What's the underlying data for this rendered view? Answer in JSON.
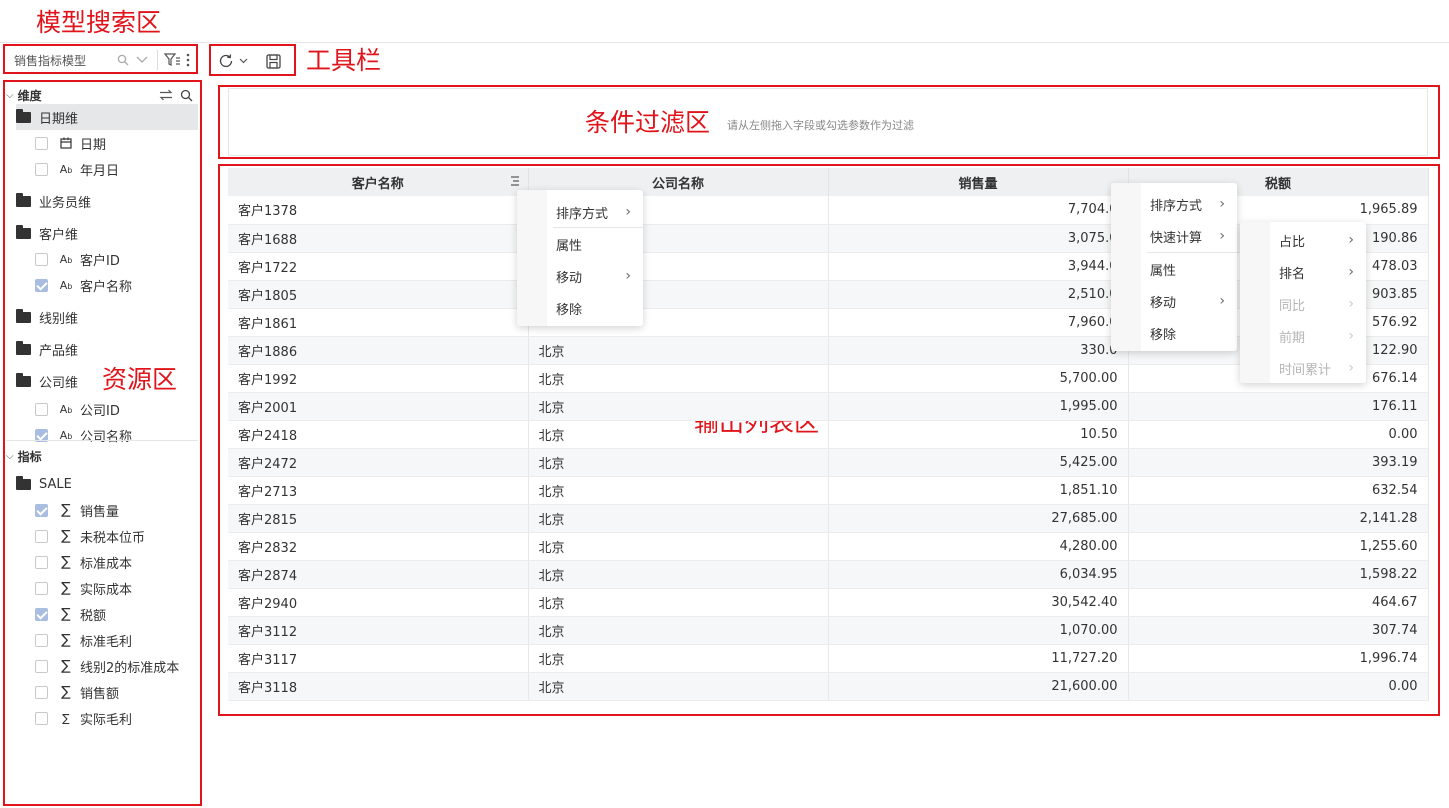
{
  "annotations": {
    "model_search": "模型搜索区",
    "toolbar": "工具栏",
    "filter": "条件过滤区",
    "resource": "资源区",
    "output": "输出列表区"
  },
  "model_search": {
    "value": "销售指标模型"
  },
  "filter_area": {
    "hint": "请从左侧拖入字段或勾选参数作为过滤"
  },
  "tree": {
    "dimension_title": "维度",
    "metric_title": "指标",
    "nodes": [
      {
        "type": "folder",
        "label": "日期维",
        "selected": true
      },
      {
        "type": "field",
        "icon": "calendar",
        "label": "日期",
        "checked": false
      },
      {
        "type": "field",
        "icon": "text",
        "label": "年月日",
        "checked": false
      },
      {
        "type": "folder",
        "label": "业务员维"
      },
      {
        "type": "folder",
        "label": "客户维"
      },
      {
        "type": "field",
        "icon": "text",
        "label": "客户ID",
        "checked": false
      },
      {
        "type": "field",
        "icon": "text",
        "label": "客户名称",
        "checked": true
      },
      {
        "type": "folder",
        "label": "线别维"
      },
      {
        "type": "folder",
        "label": "产品维"
      },
      {
        "type": "folder",
        "label": "公司维"
      },
      {
        "type": "field",
        "icon": "text",
        "label": "公司ID",
        "checked": false
      },
      {
        "type": "field",
        "icon": "text",
        "label": "公司名称",
        "checked": true
      }
    ],
    "metrics": [
      {
        "type": "folder",
        "label": "SALE"
      },
      {
        "icon": "sigma",
        "label": "销售量",
        "checked": true
      },
      {
        "icon": "sigma",
        "label": "未税本位币",
        "checked": false
      },
      {
        "icon": "sigma",
        "label": "标准成本",
        "checked": false
      },
      {
        "icon": "sigma",
        "label": "实际成本",
        "checked": false
      },
      {
        "icon": "sigma",
        "label": "税额",
        "checked": true
      },
      {
        "icon": "sigma",
        "label": "标准毛利",
        "checked": false
      },
      {
        "icon": "sigma",
        "label": "线别2的标准成本",
        "checked": false
      },
      {
        "icon": "sigma",
        "label": "销售额",
        "checked": false
      },
      {
        "icon": "calc-sigma",
        "label": "实际毛利",
        "checked": false
      }
    ]
  },
  "table": {
    "columns": [
      "客户名称",
      "公司名称",
      "销售量",
      "税额"
    ],
    "rows": [
      [
        "客户1378",
        "",
        "7,704.0",
        "1,965.89"
      ],
      [
        "客户1688",
        "",
        "3,075.0",
        "190.86"
      ],
      [
        "客户1722",
        "",
        "3,944.0",
        "478.03"
      ],
      [
        "客户1805",
        "",
        "2,510.0",
        "903.85"
      ],
      [
        "客户1861",
        "",
        "7,960.0",
        "576.92"
      ],
      [
        "客户1886",
        "北京",
        "330.0",
        "122.90"
      ],
      [
        "客户1992",
        "北京",
        "5,700.00",
        "676.14"
      ],
      [
        "客户2001",
        "北京",
        "1,995.00",
        "176.11"
      ],
      [
        "客户2418",
        "北京",
        "10.50",
        "0.00"
      ],
      [
        "客户2472",
        "北京",
        "5,425.00",
        "393.19"
      ],
      [
        "客户2713",
        "北京",
        "1,851.10",
        "632.54"
      ],
      [
        "客户2815",
        "北京",
        "27,685.00",
        "2,141.28"
      ],
      [
        "客户2832",
        "北京",
        "4,280.00",
        "1,255.60"
      ],
      [
        "客户2874",
        "北京",
        "6,034.95",
        "1,598.22"
      ],
      [
        "客户2940",
        "北京",
        "30,542.40",
        "464.67"
      ],
      [
        "客户3112",
        "北京",
        "1,070.00",
        "307.74"
      ],
      [
        "客户3117",
        "北京",
        "11,727.20",
        "1,996.74"
      ],
      [
        "客户3118",
        "北京",
        "21,600.00",
        "0.00"
      ]
    ]
  },
  "menus": {
    "col1": [
      {
        "label": "排序方式",
        "submenu": true
      },
      {
        "label": "属性",
        "submenu": false
      },
      {
        "label": "移动",
        "submenu": true
      },
      {
        "label": "移除",
        "submenu": false
      }
    ],
    "col3": [
      {
        "label": "排序方式",
        "submenu": true
      },
      {
        "label": "快速计算",
        "submenu": true
      },
      {
        "label": "属性",
        "submenu": false
      },
      {
        "label": "移动",
        "submenu": true
      },
      {
        "label": "移除",
        "submenu": false
      }
    ],
    "quick_calc": [
      {
        "label": "占比",
        "enabled": true
      },
      {
        "label": "排名",
        "enabled": true
      },
      {
        "label": "同比",
        "enabled": false
      },
      {
        "label": "前期",
        "enabled": false
      },
      {
        "label": "时间累计",
        "enabled": false
      }
    ]
  }
}
